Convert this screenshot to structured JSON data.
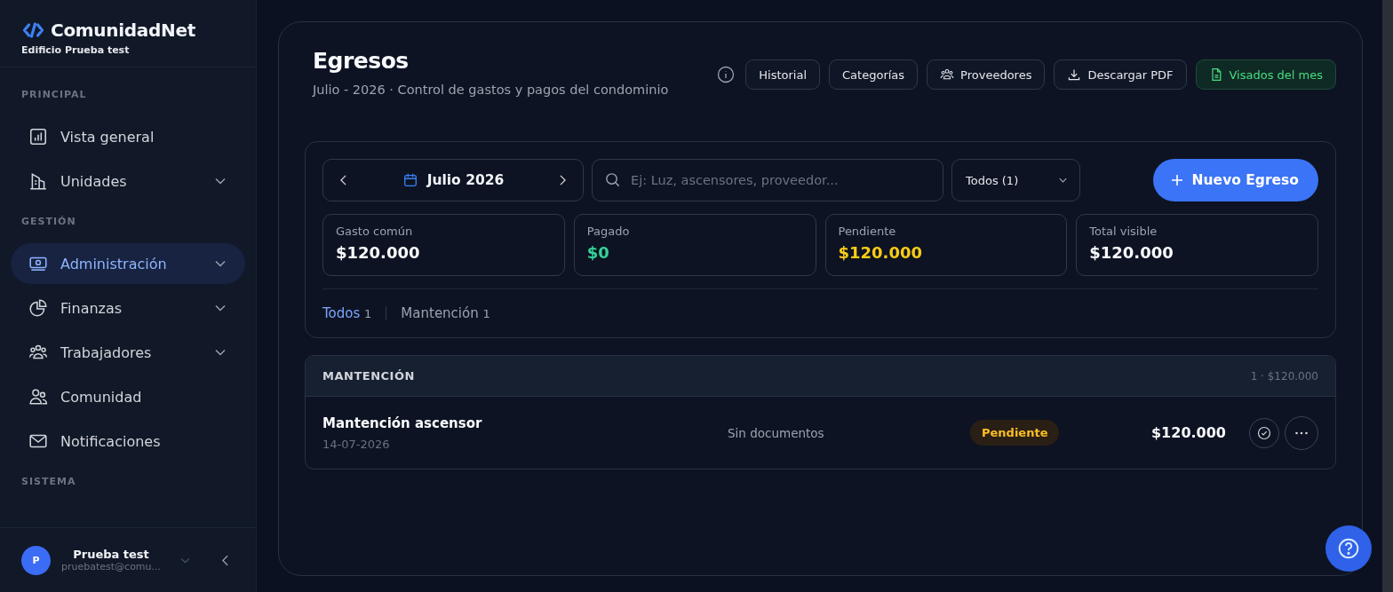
{
  "brand": {
    "name": "ComunidadNet",
    "subtitle": "Edificio Prueba test"
  },
  "sidebar": {
    "sections": [
      {
        "title": "PRINCIPAL",
        "items": [
          {
            "label": "Vista general",
            "expandable": false,
            "selected": false
          },
          {
            "label": "Unidades",
            "expandable": true,
            "selected": false
          }
        ]
      },
      {
        "title": "GESTIÓN",
        "items": [
          {
            "label": "Administración",
            "expandable": true,
            "selected": true
          },
          {
            "label": "Finanzas",
            "expandable": true,
            "selected": false
          },
          {
            "label": "Trabajadores",
            "expandable": true,
            "selected": false
          },
          {
            "label": "Comunidad",
            "expandable": false,
            "selected": false
          },
          {
            "label": "Notificaciones",
            "expandable": false,
            "selected": false
          }
        ]
      },
      {
        "title": "SISTEMA"
      }
    ]
  },
  "user": {
    "initial": "P",
    "name": "Prueba test",
    "email": "pruebatest@comu..."
  },
  "header": {
    "title": "Egresos",
    "subtitle": "Julio - 2026 · Control de gastos y pagos del condominio",
    "actions": [
      "Historial",
      "Categorías",
      "Proveedores",
      "Descargar PDF",
      "Visados del mes"
    ]
  },
  "filters": {
    "month": "Julio 2026",
    "search_placeholder": "Ej: Luz, ascensores, proveedor...",
    "category": "Todos (1)",
    "new_button": "Nuevo Egreso"
  },
  "stats": [
    {
      "label": "Gasto común",
      "value": "$120.000",
      "color": "#f8fafc"
    },
    {
      "label": "Pagado",
      "value": "$0",
      "color": "#34d399"
    },
    {
      "label": "Pendiente",
      "value": "$120.000",
      "color": "#facc15"
    },
    {
      "label": "Total visible",
      "value": "$120.000",
      "color": "#f8fafc"
    }
  ],
  "tabs": [
    {
      "label": "Todos",
      "count": "1",
      "selected": true
    },
    {
      "label": "Mantención",
      "count": "1",
      "selected": false
    }
  ],
  "group": {
    "title": "MANTENCIÓN",
    "summary": "1 · $120.000",
    "rows": [
      {
        "name": "Mantención ascensor",
        "date": "14-07-2026",
        "documents": "Sin documentos",
        "status": "Pendiente",
        "amount": "$120.000"
      }
    ]
  }
}
